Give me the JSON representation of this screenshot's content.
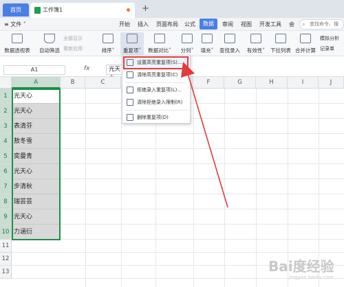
{
  "tabs": {
    "home_label": "首页",
    "doc_title": "工作簿1",
    "add_label": "+"
  },
  "menu": {
    "file_label": "≡ 文件 ˅",
    "items": [
      "开始",
      "插入",
      "页面布局",
      "公式",
      "数据",
      "审阅",
      "视图",
      "开发工具"
    ],
    "active_item": "数据",
    "more_label": "会",
    "search_placeholder": "查找命令、搜"
  },
  "ribbon": {
    "buttons": [
      "数据透视表",
      "自动筛选",
      "排序˅",
      "重复项˅",
      "数据对比˅",
      "分列˅",
      "填充˅",
      "查找录入",
      "有效性˅",
      "下拉列表",
      "合并计算",
      "记录单"
    ],
    "show_all_label": "全部显示",
    "reapply_label": "重新应用",
    "simulate_label": "模拟分析"
  },
  "formula_bar": {
    "name_box": "A1",
    "fx_label": "fx",
    "value": "光天心"
  },
  "grid": {
    "columns": [
      "A",
      "B",
      "C",
      "D",
      "E",
      "F",
      "G",
      "H",
      "I",
      "J"
    ],
    "selected_column": "A",
    "rows": [
      "1",
      "2",
      "3",
      "4",
      "5",
      "6",
      "7",
      "8",
      "9",
      "10",
      "11",
      "12",
      "13"
    ],
    "column_a_values": [
      "光天心",
      "光天心",
      "表清芬",
      "敖冬雪",
      "奕曼青",
      "光天心",
      "步清秋",
      "瑞芸芸",
      "光天心",
      "力涵衍"
    ]
  },
  "dropdown": {
    "items": [
      "设置高亮重复项(S)...",
      "清除高亮重复项(C)",
      "拒绝录入重复项(L)...",
      "清除拒绝录入限制(R)",
      "删除重复项(D)"
    ],
    "highlighted_item": "设置高亮重复项(S)..."
  },
  "colors": {
    "accent": "#4a7fe6",
    "selection_border": "#1c8f45",
    "highlight_box": "#e23b3b",
    "arrow": "#e23b3b"
  },
  "watermark": {
    "text": "Bai度经验",
    "sub": "jingyan.baidu.com"
  }
}
